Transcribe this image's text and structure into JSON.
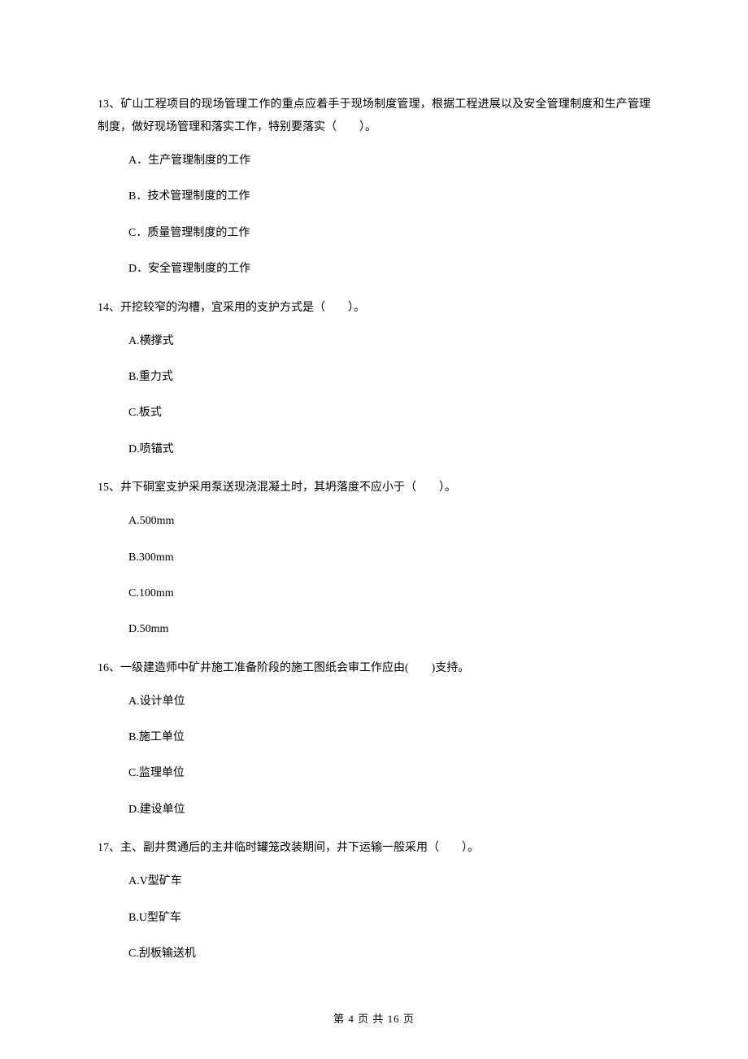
{
  "questions": [
    {
      "num": "13、",
      "text": "矿山工程项目的现场管理工作的重点应着手于现场制度管理，根据工程进展以及安全管理制度和生产管理制度，做好现场管理和落实工作，特别要落实（　　）。",
      "options": [
        "A．生产管理制度的工作",
        "B．技术管理制度的工作",
        "C．质量管理制度的工作",
        "D．安全管理制度的工作"
      ]
    },
    {
      "num": "14、",
      "text": "开挖较窄的沟槽，宜采用的支护方式是（　　）。",
      "options": [
        "A.横撑式",
        "B.重力式",
        "C.板式",
        "D.喷锚式"
      ]
    },
    {
      "num": "15、",
      "text": "井下硐室支护采用泵送现浇混凝土时，其坍落度不应小于（　　）。",
      "options": [
        "A.500mm",
        "B.300mm",
        "C.100mm",
        "D.50mm"
      ]
    },
    {
      "num": "16、",
      "text": "一级建造师中矿井施工准备阶段的施工图纸会审工作应由(　　)支持。",
      "options": [
        "A.设计单位",
        "B.施工单位",
        "C.监理单位",
        "D.建设单位"
      ]
    },
    {
      "num": "17、",
      "text": "主、副井贯通后的主井临时罐笼改装期间，井下运输一般采用（　　）。",
      "options": [
        "A.V型矿车",
        "B.U型矿车",
        "C.刮板输送机"
      ]
    }
  ],
  "footer": "第 4 页 共 16 页"
}
